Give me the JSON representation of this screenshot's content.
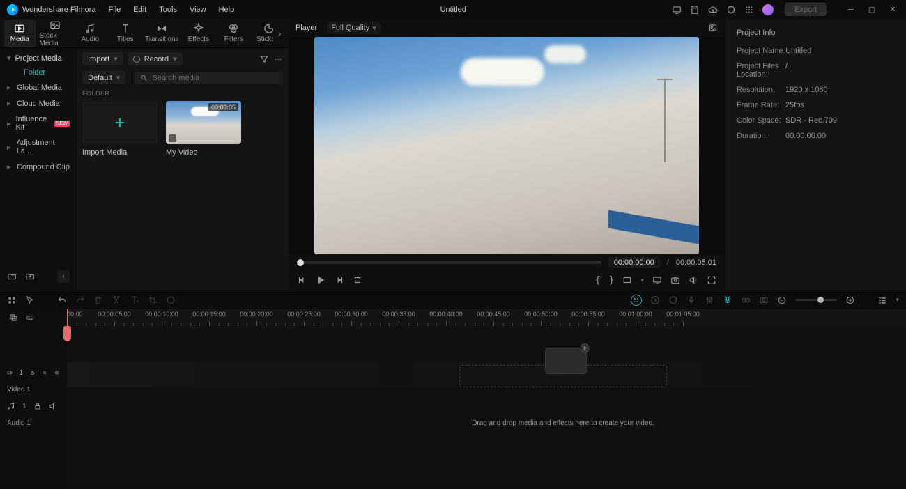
{
  "app_name": "Wondershare Filmora",
  "document_title": "Untitled",
  "export_label": "Export",
  "menus": [
    "File",
    "Edit",
    "Tools",
    "View",
    "Help"
  ],
  "categories": [
    {
      "label": "Media",
      "active": true
    },
    {
      "label": "Stock Media"
    },
    {
      "label": "Audio"
    },
    {
      "label": "Titles"
    },
    {
      "label": "Transitions"
    },
    {
      "label": "Effects"
    },
    {
      "label": "Filters"
    },
    {
      "label": "Stickers"
    }
  ],
  "tree": {
    "root": "Project Media",
    "folder": "Folder",
    "items": [
      "Global Media",
      "Cloud Media",
      "Influence Kit",
      "Adjustment La...",
      "Compound Clip"
    ],
    "new_item_index": 2
  },
  "import_label": "Import",
  "record_label": "Record",
  "sort_label": "Default",
  "search_placeholder": "Search media",
  "folder_header": "FOLDER",
  "thumbs": {
    "import": "Import Media",
    "clip": {
      "name": "My Video",
      "duration": "00:00:05"
    }
  },
  "preview": {
    "tab": "Player",
    "quality": "Full Quality",
    "cur": "00:00:00:00",
    "total": "00:00:05:01"
  },
  "info": {
    "title": "Project Info",
    "rows": [
      {
        "k": "Project Name:",
        "v": "Untitled"
      },
      {
        "k": "Project Files Location:",
        "v": "/"
      },
      {
        "k": "Resolution:",
        "v": "1920 x 1080"
      },
      {
        "k": "Frame Rate:",
        "v": "25fps"
      },
      {
        "k": "Color Space:",
        "v": "SDR - Rec.709"
      },
      {
        "k": "Duration:",
        "v": "00:00:00:00"
      }
    ]
  },
  "timeline": {
    "start": "00:00",
    "marks": [
      "00:00:05:00",
      "00:00:10:00",
      "00:00:15:00",
      "00:00:20:00",
      "00:00:25:00",
      "00:00:30:00",
      "00:00:35:00",
      "00:00:40:00",
      "00:00:45:00",
      "00:00:50:00",
      "00:00:55:00",
      "00:01:00:00",
      "00:01:05:00"
    ],
    "drop_text": "Drag and drop media and effects here to create your video.",
    "video_track": "Video 1",
    "audio_track": "Audio 1"
  }
}
